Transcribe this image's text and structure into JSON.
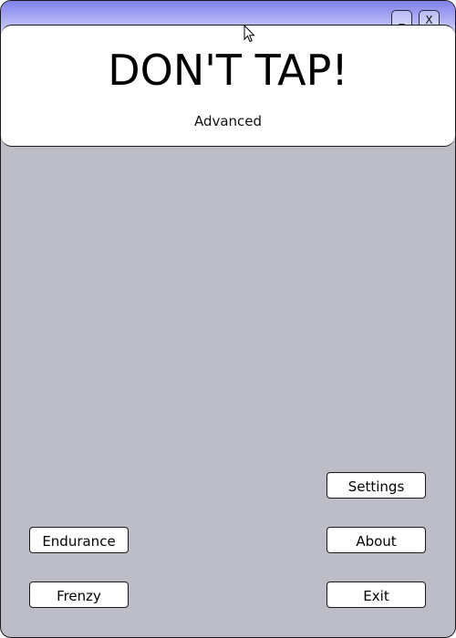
{
  "window": {
    "minimize_label": "_",
    "close_label": "X"
  },
  "header": {
    "title": "DON'T TAP!",
    "subtitle": "Advanced"
  },
  "menu": {
    "settings": "Settings",
    "endurance": "Endurance",
    "about": "About",
    "frenzy": "Frenzy",
    "exit": "Exit"
  },
  "colors": {
    "background": "#bdbdc8",
    "titlebar_top": "#8080ee",
    "titlebar_bottom": "#ececfc",
    "button_bg": "#ffffff"
  }
}
